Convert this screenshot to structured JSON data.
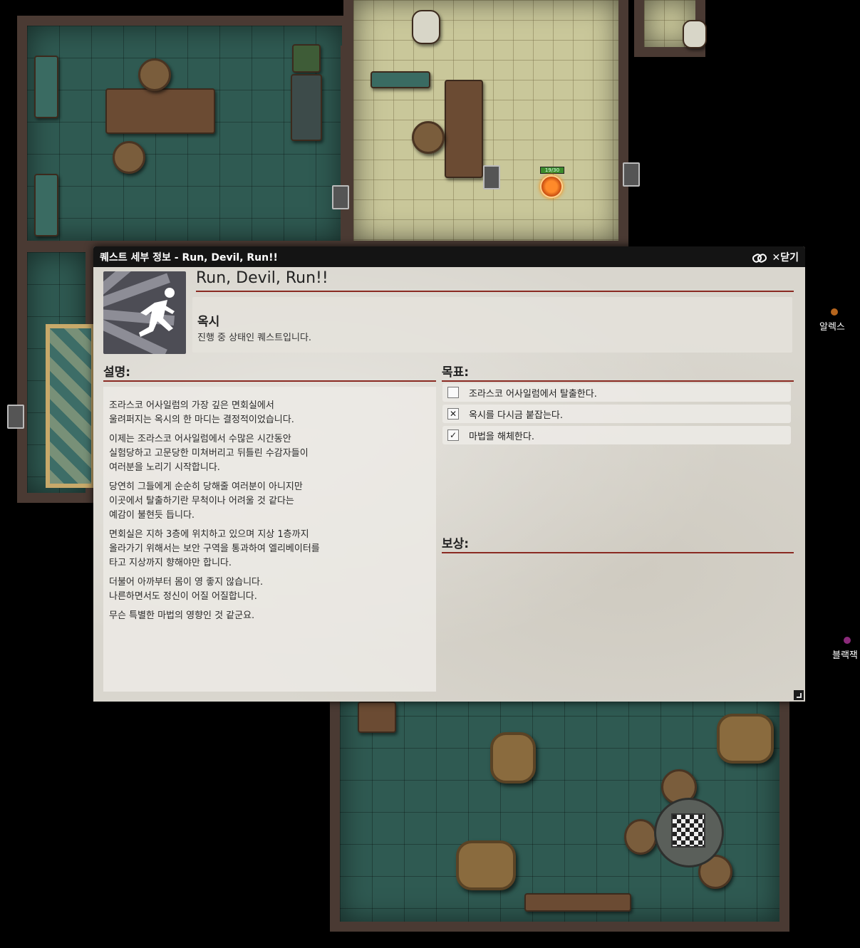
{
  "map": {
    "players": [
      {
        "name": "알렉스",
        "color": "#b5651d"
      },
      {
        "name": "블랙잭",
        "color": "#8b2a7a"
      }
    ],
    "token": {
      "hp": "19/30"
    }
  },
  "dialog": {
    "title": "퀘스트 세부 정보 - Run, Devil, Run!!",
    "close_label": "✕닫기",
    "quest_name": "Run, Devil, Run!!",
    "giver": "옥시",
    "status": "진행 중 상태인 퀘스트입니다.",
    "description_heading": "설명:",
    "description": [
      "조라스코 어사일럼의 가장 깊은 면회실에서\n울려퍼지는 옥시의 한 마디는 결정적이었습니다.",
      "이제는 조라스코 어사일럼에서 수많은 시간동안\n실험당하고 고문당한 미쳐버리고 뒤틀린 수감자들이\n여러분을 노리기 시작합니다.",
      "당연히 그들에게 순순히 당해줄 여러분이 아니지만\n이곳에서 탈출하기란 무척이나 어려울 것 같다는\n예감이 불현듯 듭니다.",
      "면회실은 지하 3층에 위치하고 있으며 지상 1층까지\n올라가기 위해서는 보안 구역을 통과하여 엘리베이터를\n타고 지상까지 향해야만 합니다.",
      "더불어 아까부터 몸이 영 좋지 않습니다.\n나른하면서도 정신이 어질 어질합니다.",
      "무슨 특별한 마법의 영향인 것 같군요."
    ],
    "objectives_heading": "목표:",
    "objectives": [
      {
        "label": "조라스코 어사일럼에서 탈출한다.",
        "state": "unchecked"
      },
      {
        "label": "옥시를 다시금 붙잡는다.",
        "state": "failed"
      },
      {
        "label": "마법을 해체한다.",
        "state": "completed"
      }
    ],
    "rewards_heading": "보상:"
  }
}
